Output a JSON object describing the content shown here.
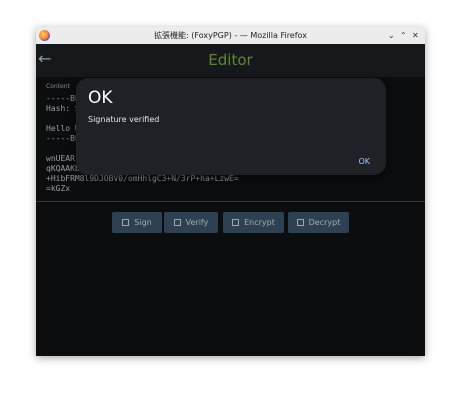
{
  "window": {
    "title": "拡張機能: (FoxyPGP) - — Mozilla Firefox",
    "controls": [
      "⌄",
      "⌃",
      "✕"
    ]
  },
  "app": {
    "title": "Editor"
  },
  "content": {
    "label": "Content",
    "lines": [
      "-----BE",
      "Hash: S",
      "",
      "Hello W",
      "-----BE",
      "",
      "wnUEAR",
      "qKQAAKE",
      "+HibFRM8l9DJOBV0/omHhlgC3+N/3rP+ha+LzwE=",
      "=kGZx"
    ]
  },
  "buttons": {
    "sign": "Sign",
    "verify": "Verify",
    "encrypt": "Encrypt",
    "decrypt": "Decrypt"
  },
  "dialog": {
    "title": "OK",
    "message": "Signature verified",
    "ok": "OK"
  },
  "colors": {
    "accent": "#86b84b",
    "button": "#3f5a74",
    "dialog_action": "#a6c8ff"
  }
}
